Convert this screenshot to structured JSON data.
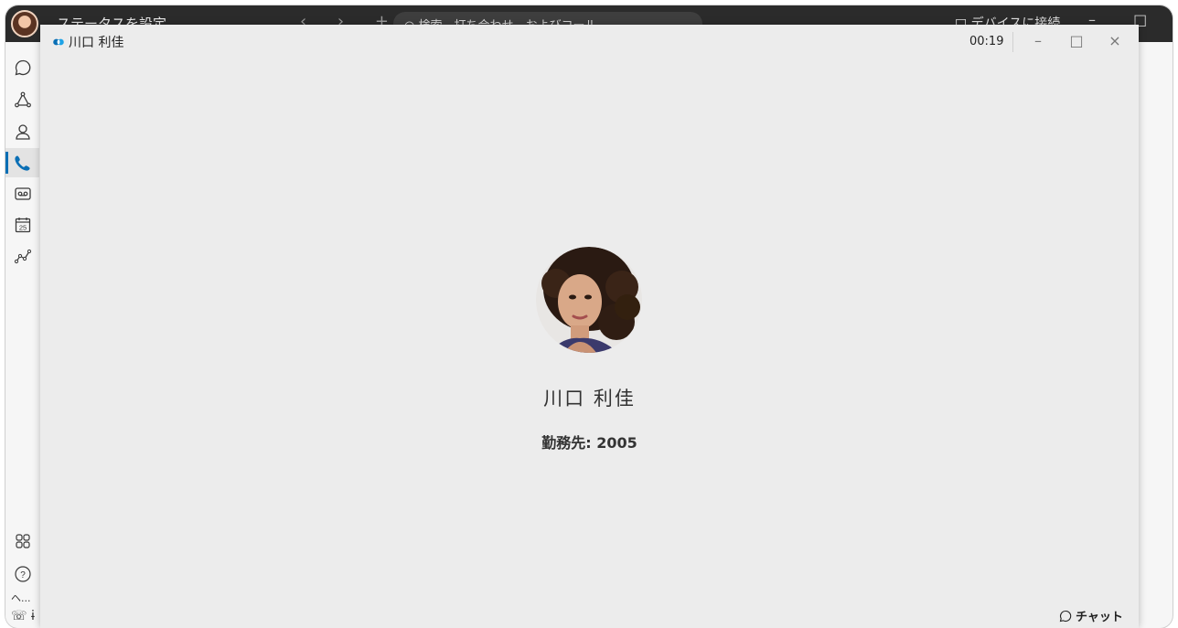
{
  "app": {
    "status_text": "ステータスを設定",
    "nav_arrows": "‹ › +",
    "search_text": "○ 検索、打ち合わせ、およびコール",
    "device_connect": "□ デバイスに接続",
    "bg_window_controls": "– □ ×"
  },
  "rail": {
    "items": [
      {
        "icon": "chat-bubble-icon",
        "active": false
      },
      {
        "icon": "teams-icon",
        "active": false
      },
      {
        "icon": "contacts-icon",
        "active": false
      },
      {
        "icon": "phone-icon",
        "active": true
      },
      {
        "icon": "voicemail-icon",
        "active": false
      },
      {
        "icon": "calendar-icon",
        "active": false,
        "text": "25"
      },
      {
        "icon": "analytics-icon",
        "active": false
      },
      {
        "icon": "apps-grid-icon",
        "active": false
      },
      {
        "icon": "help-icon",
        "active": false
      }
    ],
    "more_label": "ヘ...",
    "call_settings_label": "☏ ɨ"
  },
  "call": {
    "title": "川口 利佳",
    "timer": "00:19",
    "window_controls": {
      "minimize": "–",
      "maximize": "□",
      "close": "×"
    },
    "contact_name": "川口 利佳",
    "work_label": "勤務先: 2005",
    "chat_label": "チャット"
  },
  "colors": {
    "accent": "#0a6fb5",
    "titlebar": "#2b2b2b",
    "call_bg": "#ececec"
  }
}
